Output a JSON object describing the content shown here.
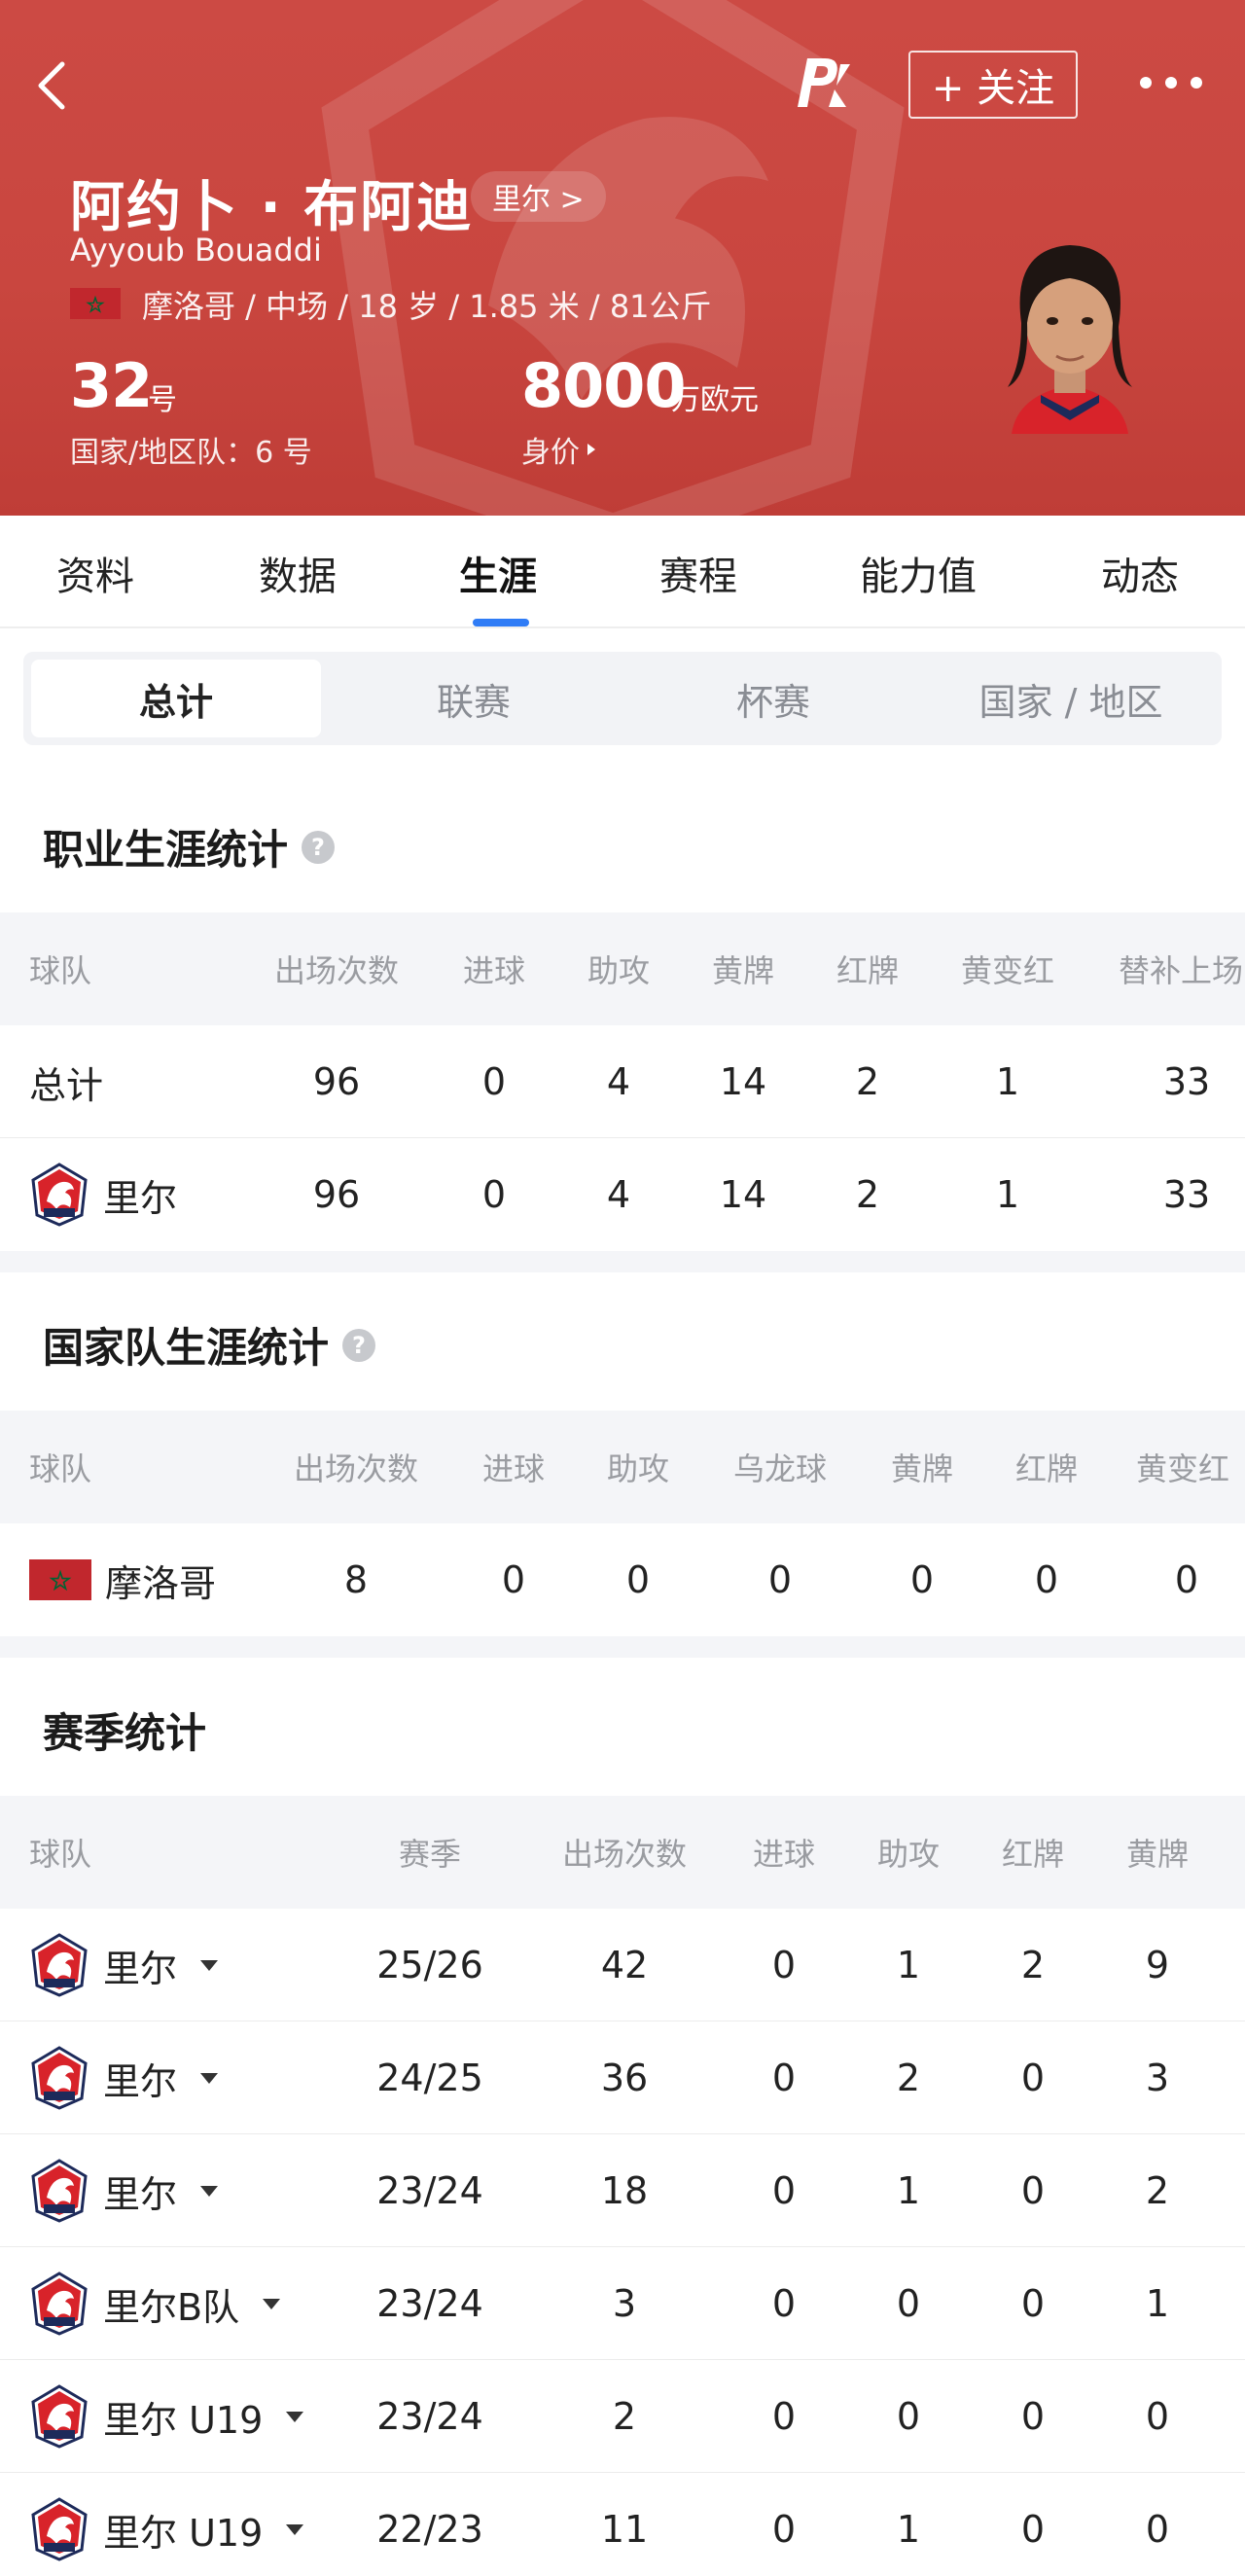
{
  "header": {
    "follow_label": "+ 关注",
    "player_name": "阿约卜 · 布阿迪",
    "club_link": "里尔 >",
    "name_en": "Ayyoub Bouaddi",
    "info_line": "摩洛哥 / 中场 / 18 岁 / 1.85 米 / 81公斤",
    "shirt_number": "32",
    "shirt_unit": "号",
    "national_number": "国家/地区队：6 号",
    "market_value": "8000",
    "market_unit": "万欧元",
    "market_label": "身价"
  },
  "tabs": [
    "资料",
    "数据",
    "生涯",
    "赛程",
    "能力值",
    "动态"
  ],
  "active_tab": "生涯",
  "segments": [
    "总计",
    "联赛",
    "杯赛",
    "国家 / 地区"
  ],
  "active_segment": "总计",
  "career": {
    "title": "职业生涯统计",
    "headers": [
      "球队",
      "出场次数",
      "进球",
      "助攻",
      "黄牌",
      "红牌",
      "黄变红",
      "替补上场"
    ],
    "rows": [
      {
        "team": "总计",
        "values": [
          "96",
          "0",
          "4",
          "14",
          "2",
          "1",
          "33"
        ]
      },
      {
        "team": "里尔",
        "values": [
          "96",
          "0",
          "4",
          "14",
          "2",
          "1",
          "33"
        ]
      }
    ]
  },
  "national": {
    "title": "国家队生涯统计",
    "headers": [
      "球队",
      "出场次数",
      "进球",
      "助攻",
      "乌龙球",
      "黄牌",
      "红牌",
      "黄变红"
    ],
    "rows": [
      {
        "team": "摩洛哥",
        "values": [
          "8",
          "0",
          "0",
          "0",
          "0",
          "0",
          "0"
        ]
      }
    ]
  },
  "season": {
    "title": "赛季统计",
    "headers": [
      "球队",
      "赛季",
      "出场次数",
      "进球",
      "助攻",
      "红牌",
      "黄牌"
    ],
    "rows": [
      {
        "team": "里尔",
        "season": "25/26",
        "values": [
          "42",
          "0",
          "1",
          "2",
          "9"
        ]
      },
      {
        "team": "里尔",
        "season": "24/25",
        "values": [
          "36",
          "0",
          "2",
          "0",
          "3"
        ]
      },
      {
        "team": "里尔",
        "season": "23/24",
        "values": [
          "18",
          "0",
          "1",
          "0",
          "2"
        ]
      },
      {
        "team": "里尔B队",
        "season": "23/24",
        "values": [
          "3",
          "0",
          "0",
          "0",
          "1"
        ]
      },
      {
        "team": "里尔 U19",
        "season": "23/24",
        "values": [
          "2",
          "0",
          "0",
          "0",
          "0"
        ]
      },
      {
        "team": "里尔 U19",
        "season": "22/23",
        "values": [
          "11",
          "0",
          "1",
          "0",
          "0"
        ]
      }
    ]
  },
  "colors": {
    "header_red": "#c9463f",
    "accent_blue": "#2f7cf6",
    "crest_red": "#d8232a",
    "crest_navy": "#1d2a5a",
    "morocco_red": "#c1272d",
    "morocco_green": "#006233"
  },
  "icons": [
    "back-arrow-icon",
    "pk-logo-icon",
    "more-dots-icon",
    "help-icon",
    "caret-down-icon",
    "losc-crest-icon",
    "morocco-flag-icon"
  ]
}
